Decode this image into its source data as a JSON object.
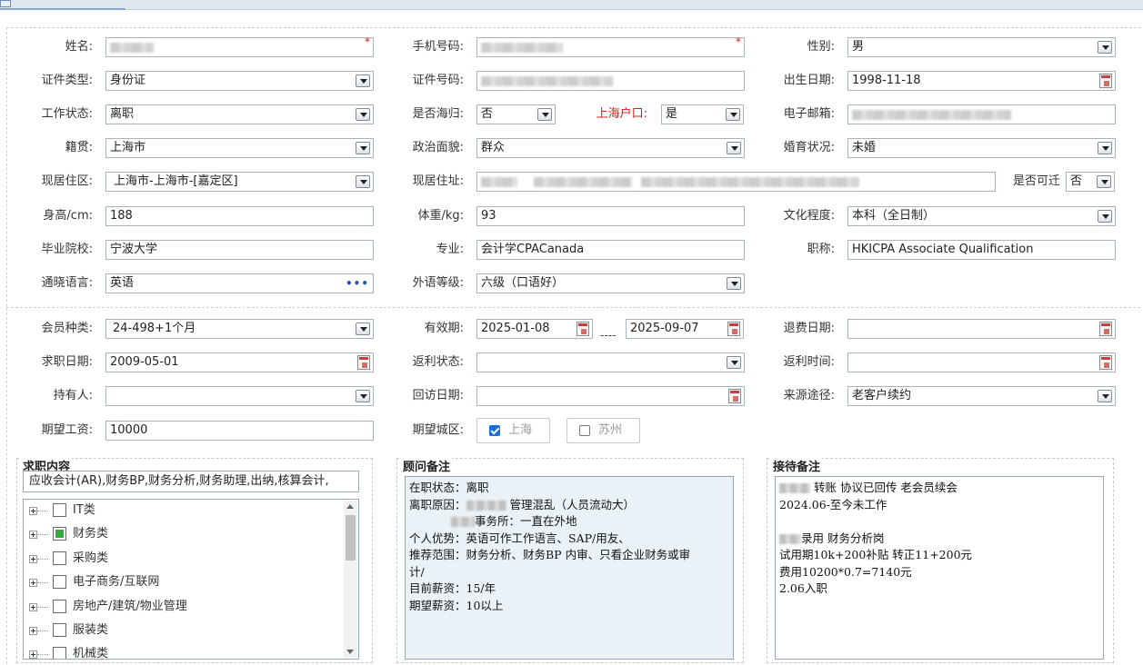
{
  "form": {
    "name": {
      "label": "姓名:",
      "value": ""
    },
    "phone": {
      "label": "手机号码:",
      "value": ""
    },
    "gender": {
      "label": "性别:",
      "value": "男"
    },
    "id_type": {
      "label": "证件类型:",
      "value": "身份证"
    },
    "id_number": {
      "label": "证件号码:",
      "value": ""
    },
    "birth_date": {
      "label": "出生日期:",
      "value": "1998-11-18"
    },
    "work_status": {
      "label": "工作状态:",
      "value": "离职"
    },
    "returnee": {
      "label": "是否海归:",
      "value": "否"
    },
    "shanghai_hukou": {
      "label": "上海户口:",
      "value": "是"
    },
    "email": {
      "label": "电子邮箱:",
      "value": ""
    },
    "native_place": {
      "label": "籍贯:",
      "value": "上海市"
    },
    "political": {
      "label": "政治面貌:",
      "value": "群众"
    },
    "marital": {
      "label": "婚育状况:",
      "value": "未婚"
    },
    "residence_area": {
      "label": "现居住区:",
      "value": "上海市-上海市-[嘉定区]"
    },
    "address": {
      "label": "现居住址:",
      "value": ""
    },
    "relocate": {
      "label": "是否可迁",
      "value": "否"
    },
    "height": {
      "label": "身高/cm:",
      "value": "188"
    },
    "weight": {
      "label": "体重/kg:",
      "value": "93"
    },
    "education": {
      "label": "文化程度:",
      "value": "本科（全日制）"
    },
    "school": {
      "label": "毕业院校:",
      "value": "宁波大学"
    },
    "major": {
      "label": "专业:",
      "value": "会计学CPACanada"
    },
    "title": {
      "label": "职称:",
      "value": "HKICPA Associate Qualification"
    },
    "language": {
      "label": "通晓语言:",
      "value": "英语"
    },
    "language_level": {
      "label": "外语等级:",
      "value": "六级（口语好）"
    }
  },
  "membership": {
    "member_type": {
      "label": "会员种类:",
      "value": "24-498+1个月"
    },
    "valid_period": {
      "label": "有效期:",
      "start": "2025-01-08",
      "separator": "----",
      "end": "2025-09-07"
    },
    "refund_date": {
      "label": "退费日期:",
      "value": ""
    },
    "job_seek_date": {
      "label": "求职日期:",
      "value": "2009-05-01"
    },
    "rebate_status": {
      "label": "返利状态:",
      "value": ""
    },
    "rebate_time": {
      "label": "返利时间:",
      "value": ""
    },
    "holder": {
      "label": "持有人:",
      "value": ""
    },
    "visit_date": {
      "label": "回访日期:",
      "value": ""
    },
    "source": {
      "label": "来源途径:",
      "value": "老客户续约"
    },
    "expected_salary": {
      "label": "期望工资:",
      "value": "10000"
    },
    "expected_city": {
      "label": "期望城区:",
      "options": [
        {
          "label": "上海",
          "checked": true
        },
        {
          "label": "苏州",
          "checked": false
        }
      ]
    }
  },
  "job_content": {
    "title": "求职内容",
    "summary": "应收会计(AR),财务BP,财务分析,财务助理,出纳,核算会计,",
    "tree": [
      {
        "label": "IT类",
        "state": "unchecked"
      },
      {
        "label": "财务类",
        "state": "partial"
      },
      {
        "label": "采购类",
        "state": "unchecked"
      },
      {
        "label": "电子商务/互联网",
        "state": "unchecked"
      },
      {
        "label": "房地产/建筑/物业管理",
        "state": "unchecked"
      },
      {
        "label": "服装类",
        "state": "unchecked"
      },
      {
        "label": "机械类",
        "state": "unchecked"
      }
    ]
  },
  "advisor_notes": {
    "title": "顾问备注",
    "lines": [
      {
        "pre": "在职状态：离职",
        "blur": 0,
        "post": ""
      },
      {
        "pre": "离职原因：",
        "blur": 44,
        "post": " 管理混乱（人员流动大）"
      },
      {
        "pre": "",
        "blur": 0,
        "post": "事务所：一直在外地",
        "indent": 72,
        "blur2": 26
      },
      {
        "pre": "个人优势：英语可作工作语言、SAP/用友、",
        "blur": 0,
        "post": ""
      },
      {
        "pre": "推荐范围：财务分析、财务BP 内审、只看企业财务或审",
        "blur": 0,
        "post": ""
      },
      {
        "pre": "计/",
        "blur": 0,
        "post": ""
      },
      {
        "pre": "目前薪资：15/年",
        "blur": 0,
        "post": ""
      },
      {
        "pre": "期望薪资：10以上",
        "blur": 0,
        "post": ""
      }
    ]
  },
  "reception_notes": {
    "title": "接待备注",
    "lines": [
      {
        "pre": "",
        "blur": 34,
        "post": "  转账  协议已回传 老会员续会"
      },
      {
        "pre": "2024.06-至今未工作",
        "blur": 0,
        "post": ""
      },
      {
        "pre": "",
        "blur": 0,
        "post": ""
      },
      {
        "pre": "",
        "blur": 24,
        "post": "录用 财务分析岗"
      },
      {
        "pre": "试用期10k+200补贴 转正11+200元",
        "blur": 0,
        "post": ""
      },
      {
        "pre": "费用10200*0.7=7140元",
        "blur": 0,
        "post": ""
      },
      {
        "pre": "2.06入职",
        "blur": 0,
        "post": ""
      }
    ]
  }
}
